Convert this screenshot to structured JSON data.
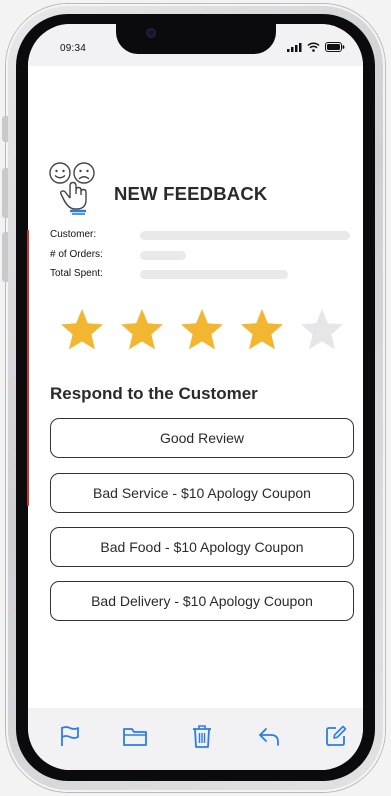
{
  "status_bar": {
    "time": "09:34"
  },
  "header": {
    "title": "NEW FEEDBACK",
    "icon": "happy-sad-faces-hand-icon"
  },
  "customer_info": {
    "rows": [
      {
        "label": "Customer:"
      },
      {
        "label": "# of Orders:"
      },
      {
        "label": "Total Spent:"
      }
    ]
  },
  "rating": {
    "value": 4,
    "max": 5,
    "filled_color": "#f2b630",
    "empty_color": "#e6e6e8"
  },
  "respond": {
    "title": "Respond to the Customer",
    "options": [
      "Good Review",
      "Bad Service - $10 Apology Coupon",
      "Bad Food - $10 Apology Coupon",
      "Bad Delivery - $10 Apology Coupon"
    ]
  },
  "toolbar": {
    "icons": [
      "flag-icon",
      "folder-icon",
      "trash-icon",
      "reply-icon",
      "compose-icon"
    ],
    "accent": "#2b7de9"
  }
}
